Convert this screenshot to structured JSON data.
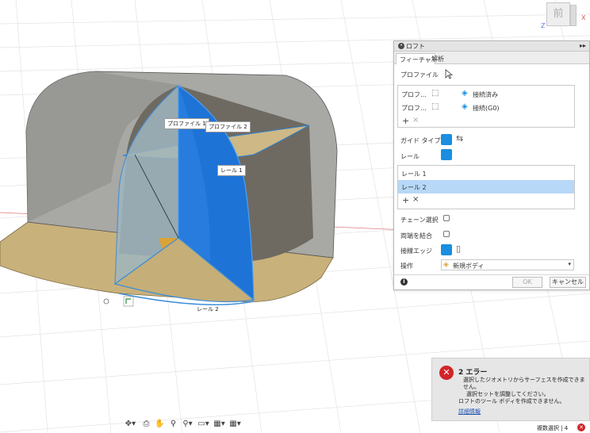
{
  "viewcube": {
    "face_label": "前",
    "axis_x": "X",
    "axis_z": "Z"
  },
  "canvas": {
    "tag_profile1": "プロファイル 1",
    "tag_profile2": "プロファイル 2",
    "tag_rail1": "レール 1",
    "label_rail2": "レール 2"
  },
  "loft": {
    "title": "ロフト",
    "expand": "▸▸",
    "tabs": [
      "フィーチャ",
      "解析"
    ],
    "profile_label": "プロファイル",
    "profiles": [
      {
        "name": "プロフ…",
        "status": "接続済み"
      },
      {
        "name": "プロフ…",
        "status": "接続(G0)"
      }
    ],
    "add_symbol": "+",
    "remove_symbol": "×",
    "guide_type_label": "ガイド タイプ",
    "rail_label": "レール",
    "rails": [
      "レール 1",
      "レール 2"
    ],
    "chain_select_label": "チェーン選択",
    "merge_ends_label": "両端を結合",
    "tangent_edges_label": "接線エッジ",
    "operation_label": "操作",
    "operation_value": "新規ボディ",
    "info_symbol": "i",
    "ok_label": "OK",
    "cancel_label": "キャンセル",
    "accent_color": "#1a8ee0",
    "selected_row_color": "#b7d8f7"
  },
  "error": {
    "icon": "✕",
    "title": "2 エラー",
    "lines": [
      "選択したジオメトリからサーフェスを作成できません。",
      "選択セットを調整してください。",
      "ロフトのツール ボディを作成できません。"
    ],
    "link": "詳細情報",
    "color": "#d3232a"
  },
  "status": {
    "multi_select": "複数選択 | 4",
    "close": "✕"
  },
  "nav_toolbar": {
    "icons": [
      "orbit-icon",
      "look-icon",
      "pan-icon",
      "zoom-fit-icon",
      "zoom-icon",
      "display-icon",
      "grid-icon",
      "viewports-icon"
    ],
    "glyphs": [
      "✥▾",
      "⎙",
      "✋",
      "⚲",
      "⚲▾",
      "▭▾",
      "▦▾",
      "▦▾"
    ]
  }
}
